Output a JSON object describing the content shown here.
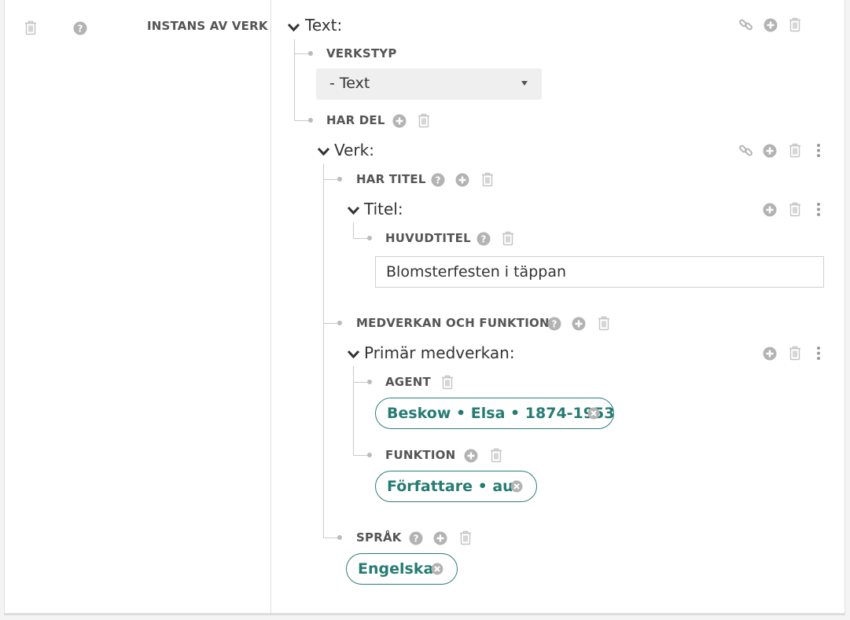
{
  "left": {
    "label": "INSTANS AV VERK"
  },
  "text_block": {
    "title": "Text:"
  },
  "verkstyp": {
    "label": "VERKSTYP",
    "selected": "- Text"
  },
  "har_del": {
    "label": "HAR DEL"
  },
  "verk": {
    "title": "Verk:"
  },
  "har_titel": {
    "label": "HAR TITEL"
  },
  "titel": {
    "title": "Titel:"
  },
  "huvudtitel": {
    "label": "HUVUDTITEL",
    "value": "Blomsterfesten i täppan"
  },
  "medverkan": {
    "label": "MEDVERKAN OCH FUNKTION"
  },
  "primar": {
    "title": "Primär medverkan:"
  },
  "agent": {
    "label": "AGENT",
    "value": "Beskow • Elsa • 1874-1953"
  },
  "funktion": {
    "label": "FUNKTION",
    "value": "Författare • aut"
  },
  "sprak": {
    "label": "SPRÅK",
    "value": "Engelska"
  },
  "colors": {
    "accent": "#267b73",
    "icon": "#b3b3b3",
    "label": "#555555"
  }
}
